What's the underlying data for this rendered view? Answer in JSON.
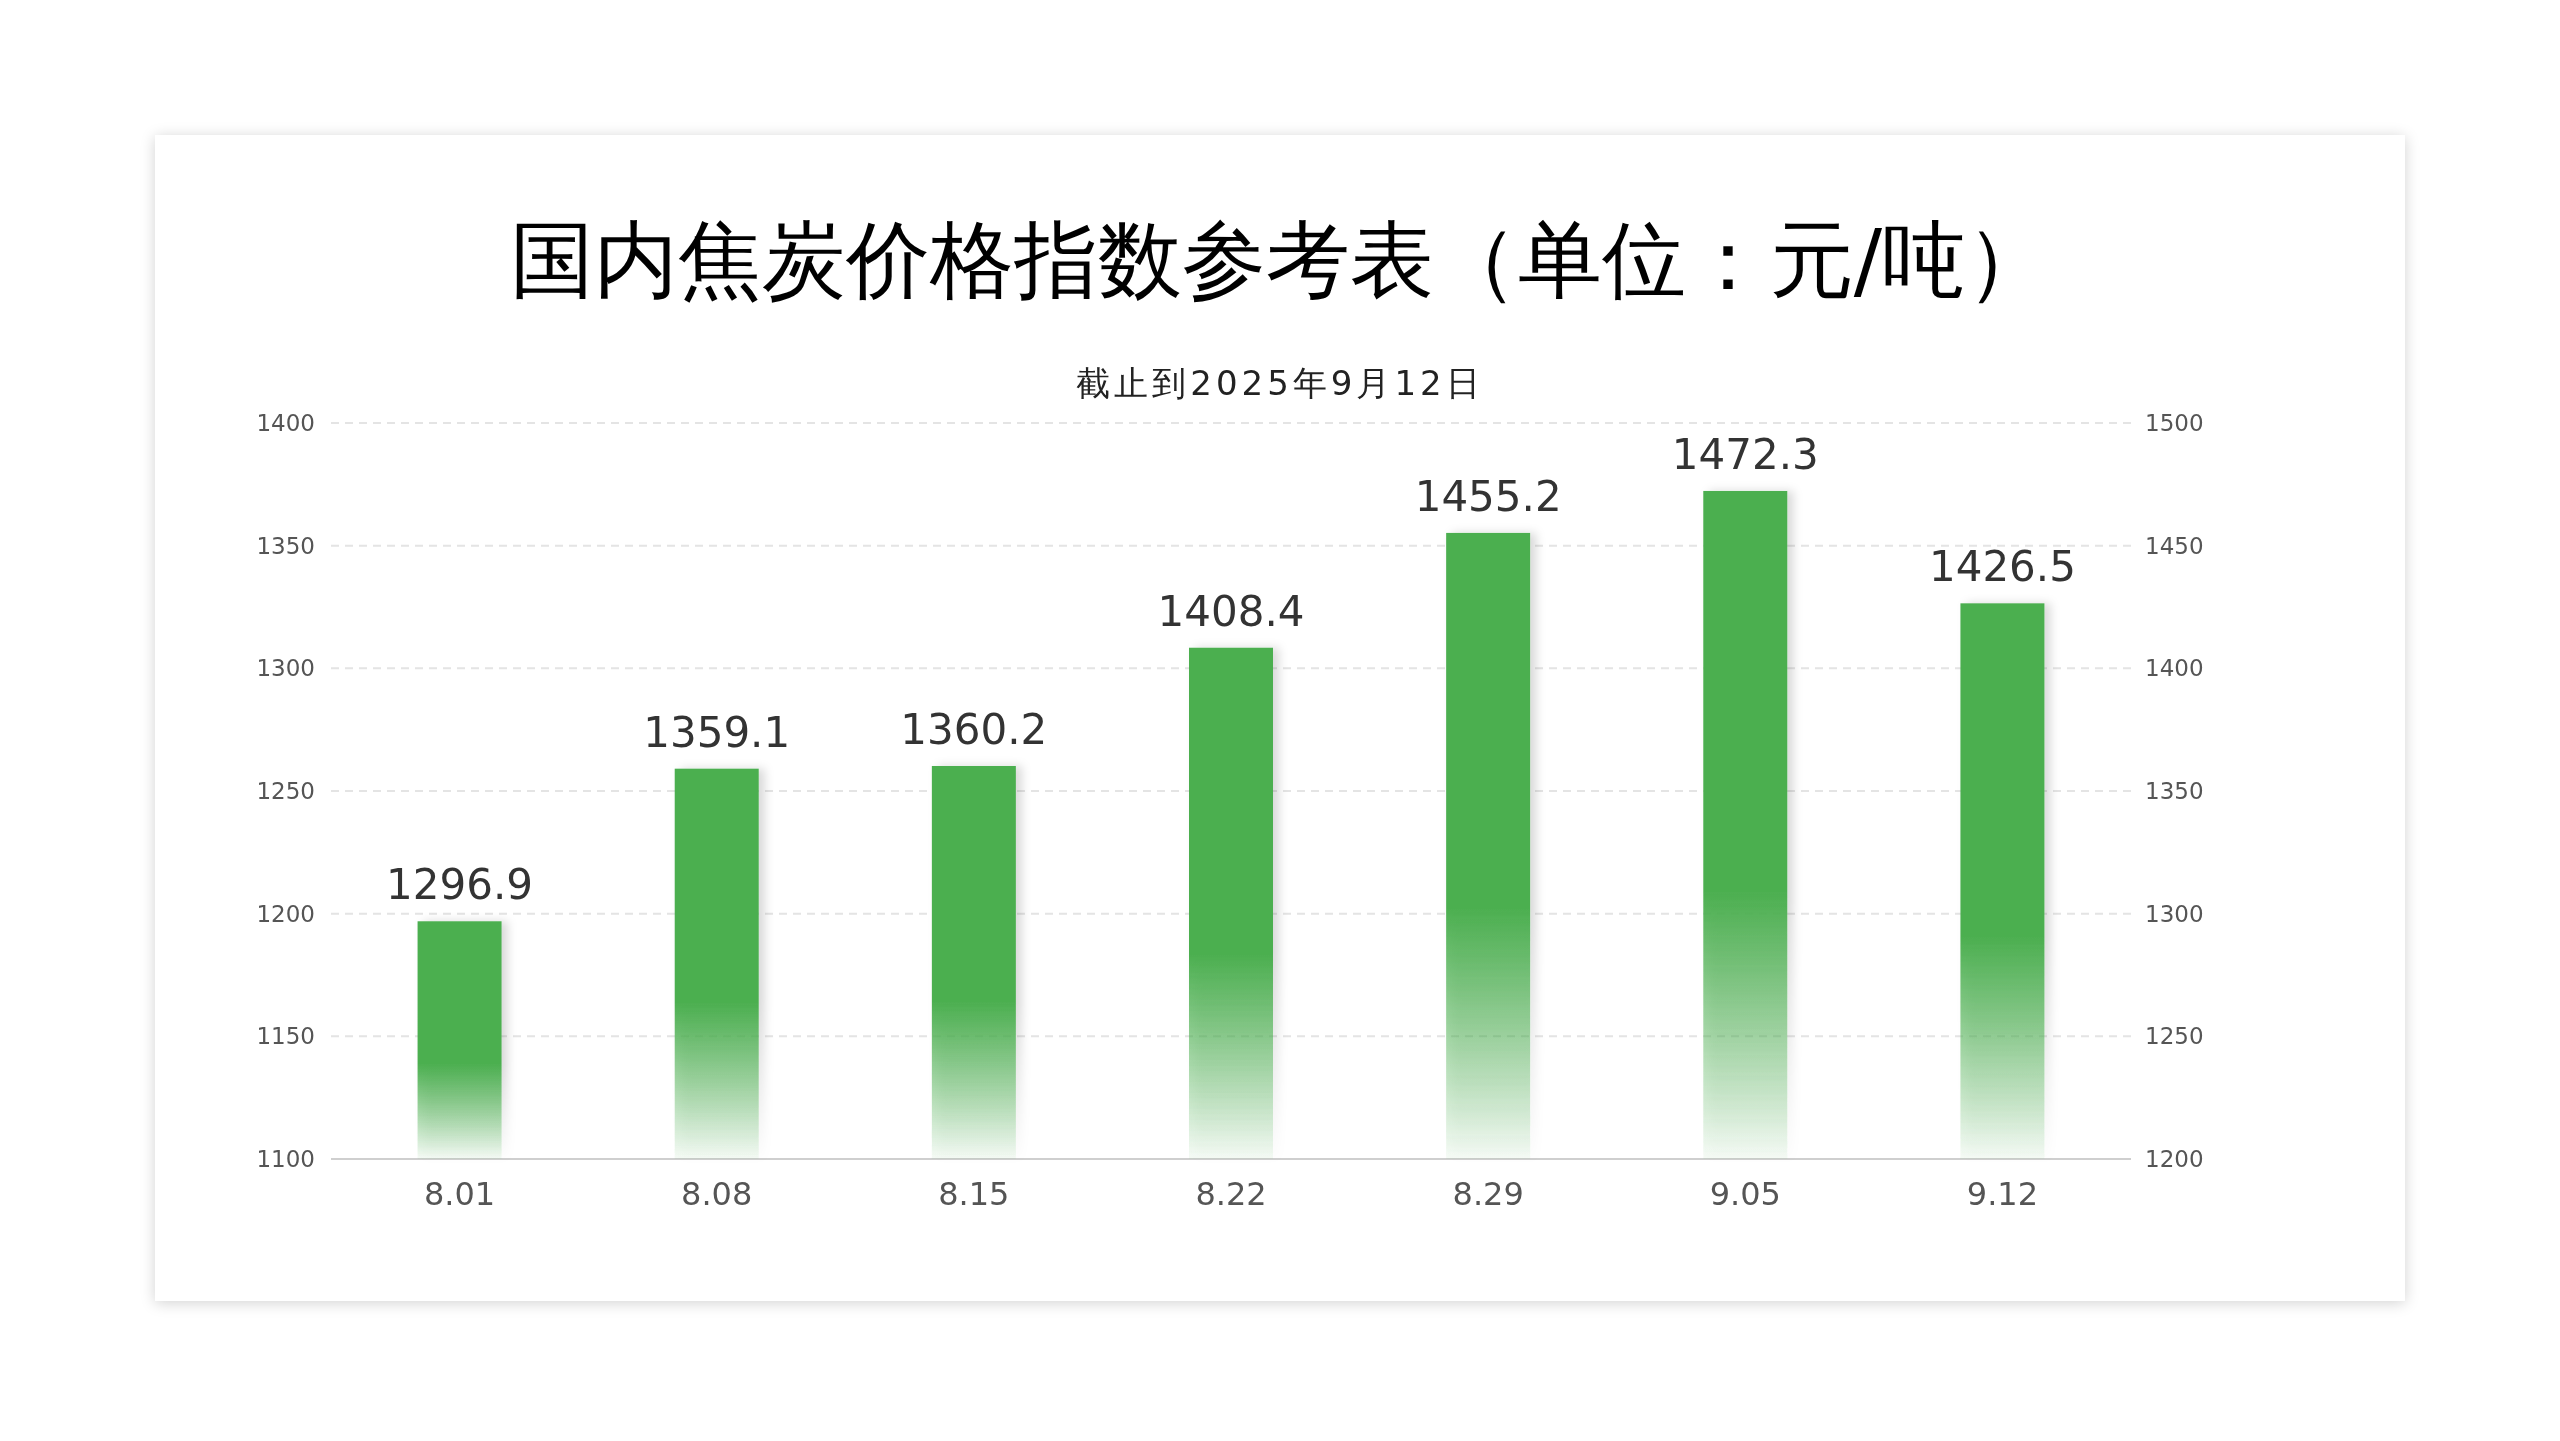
{
  "title": "国内焦炭价格指数参考表（单位：元/吨）",
  "chart": {
    "chart_data": {
      "type": "bar",
      "title": "截止到2025年9月12日",
      "categories": [
        "8.01",
        "8.08",
        "8.15",
        "8.22",
        "8.29",
        "9.05",
        "9.12"
      ],
      "series": [
        {
          "color": "#4caf50",
          "values": [
            1296.9,
            1359.1,
            1360.2,
            1408.4,
            1455.2,
            1472.3,
            1426.5
          ]
        }
      ],
      "ylim": [
        1200,
        1500
      ],
      "yticks": [
        1500,
        1450,
        1400,
        1350,
        1300,
        1250,
        1200
      ],
      "grid": true,
      "data_labels": true
    },
    "left_axis_labels": [
      "1400",
      "1350",
      "1300",
      "1250",
      "1200",
      "1150",
      "1100"
    ]
  }
}
